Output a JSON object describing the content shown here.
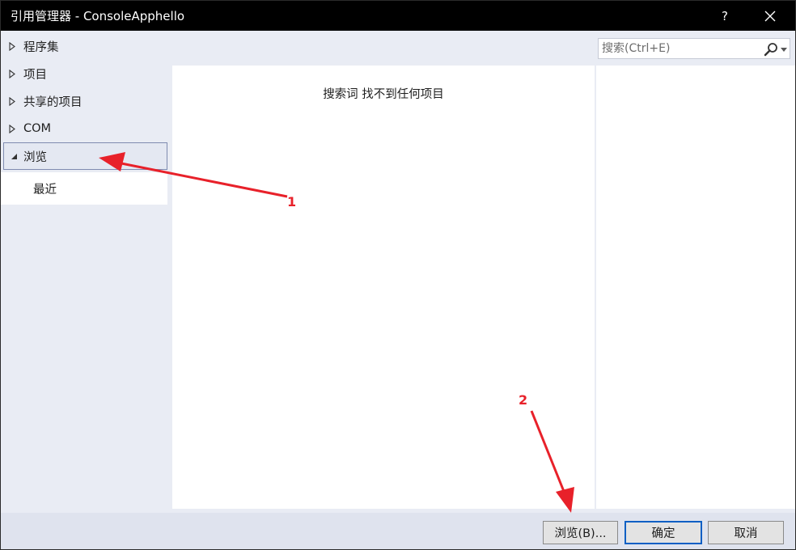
{
  "window": {
    "title": "引用管理器 - ConsoleApphello",
    "help_label": "?",
    "close_label": "✕"
  },
  "sidebar": {
    "items": [
      {
        "label": "程序集",
        "expanded": false
      },
      {
        "label": "项目",
        "expanded": false
      },
      {
        "label": "共享的项目",
        "expanded": false
      },
      {
        "label": "COM",
        "expanded": false
      },
      {
        "label": "浏览",
        "expanded": true,
        "selected": true
      }
    ],
    "sub_items": [
      {
        "label": "最近"
      }
    ]
  },
  "search": {
    "placeholder": "搜索(Ctrl+E)",
    "icon": "search-icon"
  },
  "main": {
    "empty_message": "搜索词 找不到任何项目"
  },
  "footer": {
    "browse_label": "浏览(B)...",
    "ok_label": "确定",
    "cancel_label": "取消"
  },
  "annotations": {
    "label_1": "1",
    "label_2": "2",
    "color": "#e8212a"
  },
  "colors": {
    "titlebar": "#000000",
    "panel": "#e9ecf4",
    "selection_border": "#7f8bb0",
    "primary_border": "#0b5fc4"
  }
}
